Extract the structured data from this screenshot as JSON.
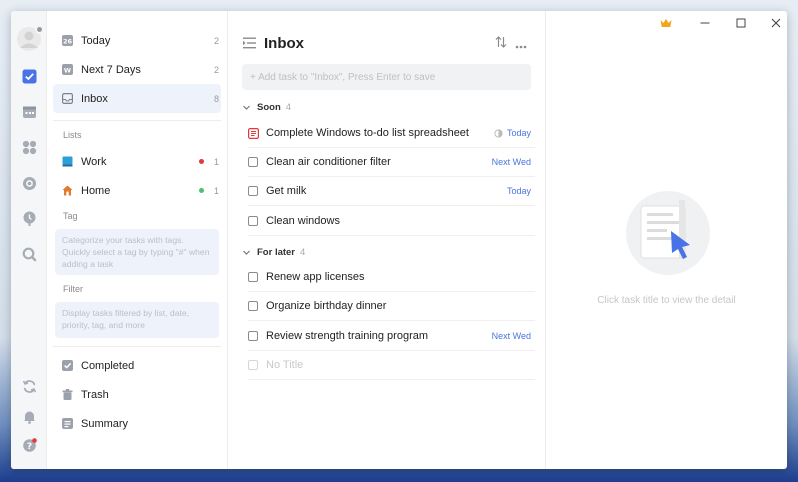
{
  "sidebar": {
    "smart_lists": [
      {
        "label": "Today",
        "count": "2",
        "icon": "calendar-day-icon"
      },
      {
        "label": "Next 7 Days",
        "count": "2",
        "icon": "calendar-week-icon"
      },
      {
        "label": "Inbox",
        "count": "8",
        "icon": "inbox-icon"
      }
    ],
    "lists_title": "Lists",
    "lists": [
      {
        "label": "Work",
        "count": "1",
        "dot_color": "#e0393e",
        "icon_color": "#2b9fd8"
      },
      {
        "label": "Home",
        "count": "1",
        "dot_color": "#4cc16b",
        "icon_color": "#e27a2f"
      }
    ],
    "tag_title": "Tag",
    "tag_hint": "Categorize your tasks with tags. Quickly select a tag by typing \"#\" when adding a task",
    "filter_title": "Filter",
    "filter_hint": "Display tasks filtered by list, date, priority, tag, and more",
    "bottom": [
      {
        "label": "Completed",
        "icon": "checkbox-icon"
      },
      {
        "label": "Trash",
        "icon": "trash-icon"
      },
      {
        "label": "Summary",
        "icon": "summary-icon"
      }
    ]
  },
  "main": {
    "title": "Inbox",
    "add_placeholder": "+ Add task to \"Inbox\", Press Enter to save",
    "groups": [
      {
        "name": "Soon",
        "count": "4",
        "tasks": [
          {
            "title": "Complete Windows to-do list spreadsheet",
            "due": "Today",
            "type": "note"
          },
          {
            "title": "Clean air conditioner filter",
            "due": "Next Wed"
          },
          {
            "title": "Get milk",
            "due": "Today"
          },
          {
            "title": "Clean windows",
            "due": ""
          }
        ]
      },
      {
        "name": "For later",
        "count": "4",
        "tasks": [
          {
            "title": "Renew app licenses",
            "due": ""
          },
          {
            "title": "Organize birthday dinner",
            "due": ""
          },
          {
            "title": "Review strength training program",
            "due": "Next Wed"
          },
          {
            "title": "No Title",
            "due": ""
          }
        ]
      }
    ]
  },
  "detail": {
    "hint": "Click task title to view the detail"
  },
  "colors": {
    "accent": "#4772e8",
    "premium": "#f3a51c"
  }
}
